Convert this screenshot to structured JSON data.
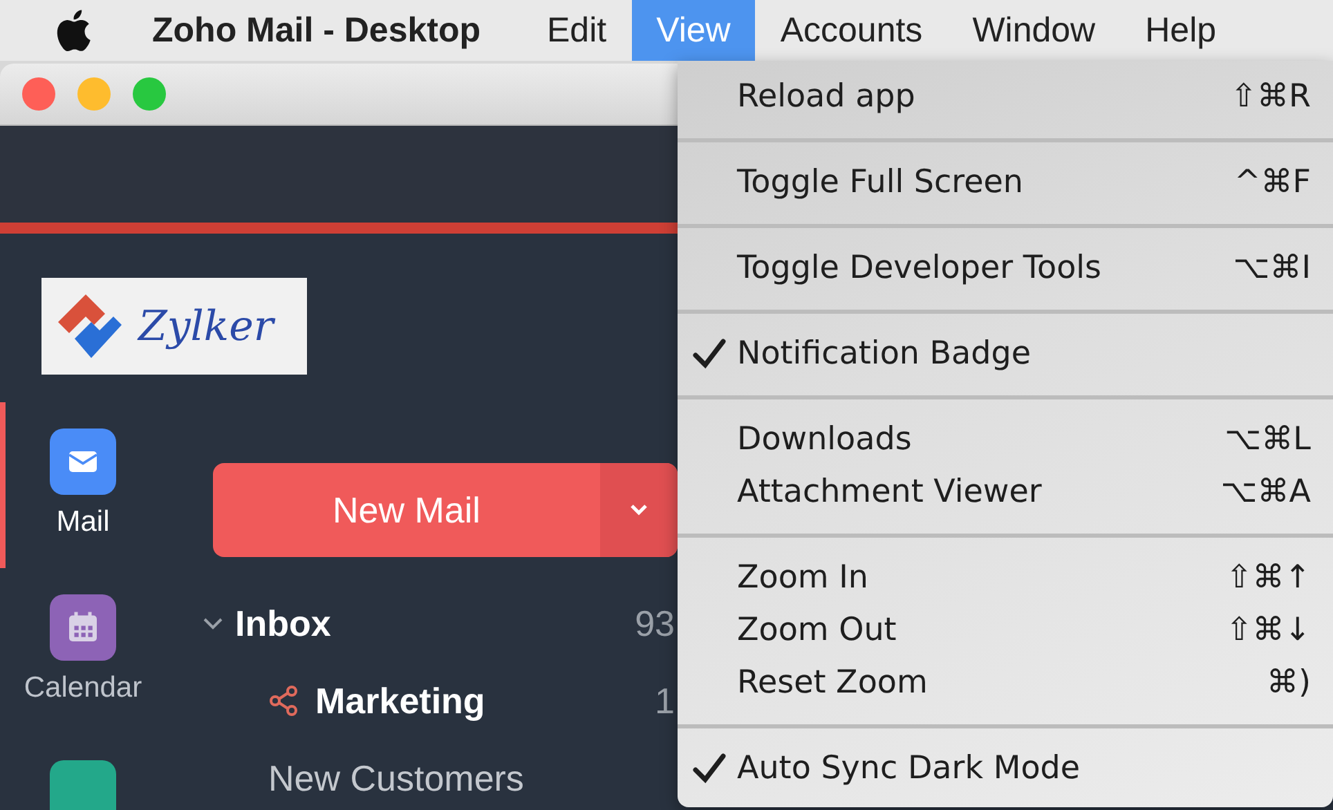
{
  "menu_bar": {
    "app_name": "Zoho Mail - Desktop",
    "menus": [
      {
        "label": "Edit",
        "selected": false
      },
      {
        "label": "View",
        "selected": true
      },
      {
        "label": "Accounts",
        "selected": false
      },
      {
        "label": "Window",
        "selected": false
      },
      {
        "label": "Help",
        "selected": false
      }
    ]
  },
  "view_menu": {
    "groups": [
      [
        {
          "label": "Reload app",
          "shortcut": "⇧⌘R",
          "checked": false
        }
      ],
      [
        {
          "label": "Toggle Full Screen",
          "shortcut": "^⌘F",
          "checked": false
        }
      ],
      [
        {
          "label": "Toggle Developer Tools",
          "shortcut": "⌥⌘I",
          "checked": false
        }
      ],
      [
        {
          "label": "Notification Badge",
          "checked": true
        }
      ],
      [
        {
          "label": "Downloads",
          "shortcut": "⌥⌘L",
          "checked": false
        },
        {
          "label": "Attachment Viewer",
          "shortcut": "⌥⌘A",
          "checked": false
        }
      ],
      [
        {
          "label": "Zoom In",
          "shortcut": "⇧⌘↑",
          "checked": false
        },
        {
          "label": "Zoom Out",
          "shortcut": "⇧⌘↓",
          "checked": false
        },
        {
          "label": "Reset Zoom",
          "shortcut": "⌘)",
          "checked": false
        }
      ],
      [
        {
          "label": "Auto Sync Dark Mode",
          "checked": true
        }
      ]
    ]
  },
  "logo": {
    "text": "Zylker"
  },
  "nav_rail": [
    {
      "kind": "mail",
      "label": "Mail",
      "selected": true
    },
    {
      "kind": "calendar",
      "label": "Calendar",
      "selected": false
    },
    {
      "kind": "other",
      "selected": false
    }
  ],
  "new_mail_button": {
    "label": "New Mail"
  },
  "folders": [
    {
      "label": "Inbox",
      "count": "93",
      "unread": true,
      "expanded": true,
      "children": [
        {
          "kind": "shared",
          "label": "Marketing",
          "count": "1",
          "unread": true
        },
        {
          "kind": "plain",
          "label": "New Customers",
          "unread": false
        }
      ]
    }
  ]
}
